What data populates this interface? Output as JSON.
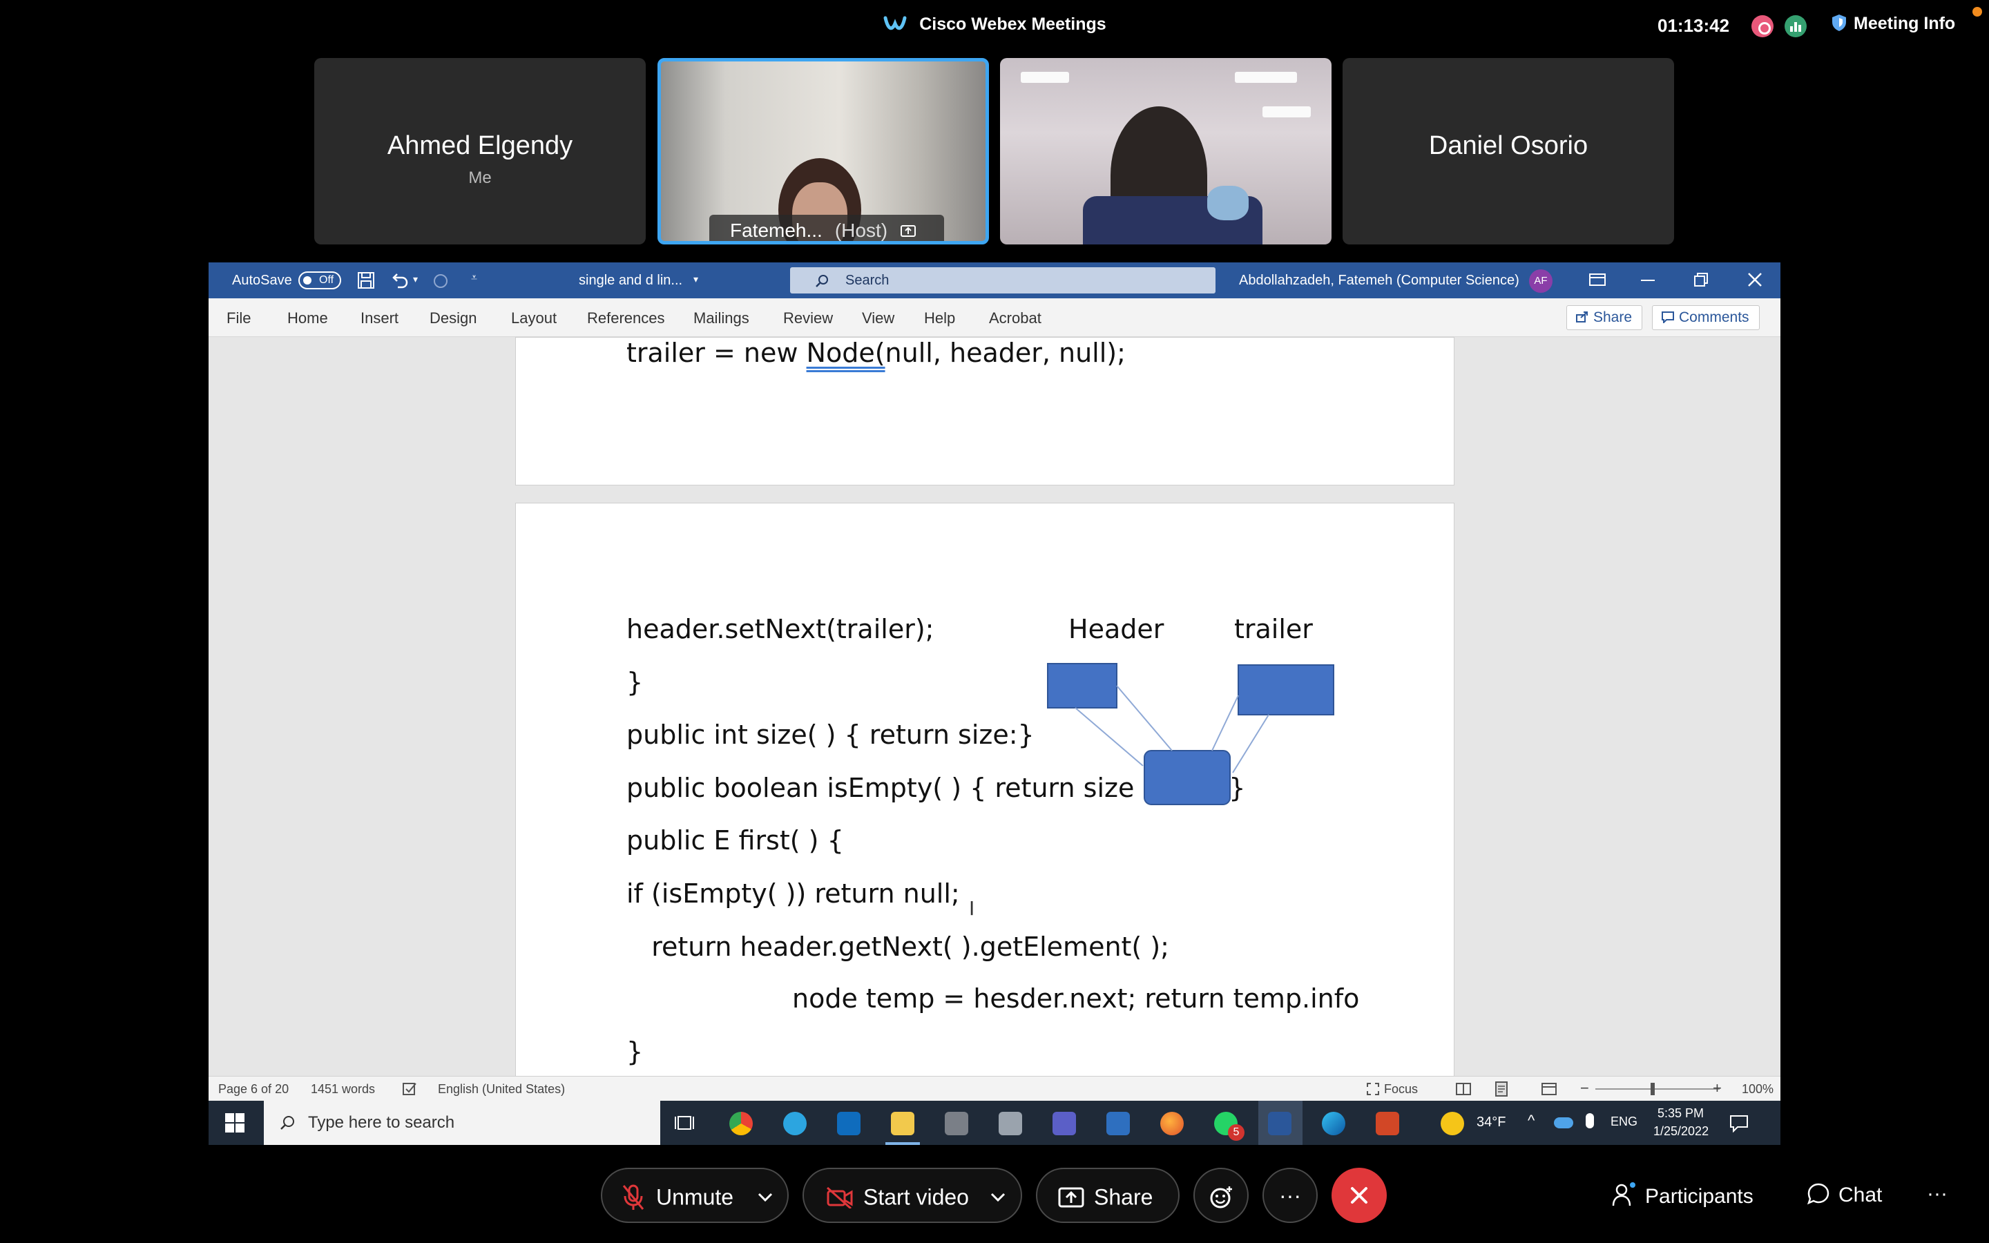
{
  "webex": {
    "app_title": "Cisco Webex Meetings",
    "timer": "01:13:42",
    "meeting_info": "Meeting Info"
  },
  "participants": [
    {
      "name": "Ahmed Elgendy",
      "subtitle": "Me"
    },
    {
      "name": "Fatemeh...",
      "role": "(Host)"
    },
    {
      "name": ""
    },
    {
      "name": "Daniel Osorio"
    }
  ],
  "word": {
    "autosave_label": "AutoSave",
    "autosave_state": "Off",
    "doc_title": "single and d lin...",
    "search_placeholder": "Search",
    "user_name": "Abdollahzadeh, Fatemeh (Computer Science)",
    "user_initials": "AF",
    "tabs": [
      "File",
      "Home",
      "Insert",
      "Design",
      "Layout",
      "References",
      "Mailings",
      "Review",
      "View",
      "Help",
      "Acrobat"
    ],
    "share_label": "Share",
    "comments_label": "Comments",
    "page1_line": "trailer = new Node(null, header, null);",
    "diagram": {
      "header_label": "Header",
      "trailer_label": "trailer"
    },
    "code_lines": [
      " header.setNext(trailer);",
      "}",
      "public int size( ) { return size:}",
      "public boolean isEmpty( ) { return size == 0; }",
      " public E first( ) {",
      " if (isEmpty( )) return null;",
      "   return header.getNext( ).getElement( );",
      "node temp = hesder.next; return temp.info",
      "}"
    ],
    "status": {
      "page": "Page 6 of 20",
      "words": "1451 words",
      "language": "English (United States)",
      "focus": "Focus",
      "zoom": "100%"
    }
  },
  "taskbar": {
    "search_placeholder": "Type here to search",
    "whatsapp_badge": "5",
    "weather": "34°F",
    "lang": "ENG",
    "time": "5:35 PM",
    "date": "1/25/2022"
  },
  "controls": {
    "unmute": "Unmute",
    "start_video": "Start video",
    "share": "Share",
    "more": "···",
    "participants": "Participants",
    "chat": "Chat",
    "overflow": "···"
  }
}
